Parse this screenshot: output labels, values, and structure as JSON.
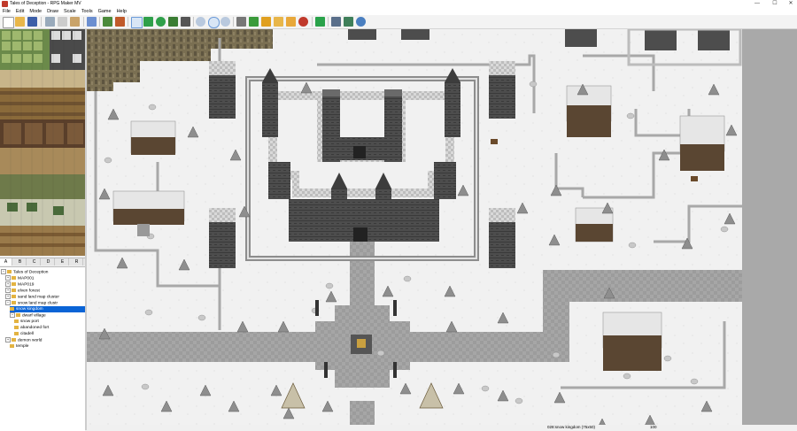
{
  "window": {
    "title": "Tales of Deception - RPG Maker MV",
    "minimize": "—",
    "maximize": "☐",
    "close": "✕"
  },
  "menu": [
    "File",
    "Edit",
    "Mode",
    "Draw",
    "Scale",
    "Tools",
    "Game",
    "Help"
  ],
  "tileset_tabs": [
    {
      "label": "A",
      "active": true
    },
    {
      "label": "B",
      "active": false
    },
    {
      "label": "C",
      "active": false
    },
    {
      "label": "D",
      "active": false
    },
    {
      "label": "E",
      "active": false
    },
    {
      "label": "R",
      "active": false
    }
  ],
  "map_tree": [
    {
      "label": "Tales of Deception",
      "level": 0,
      "expander": "−",
      "selected": false
    },
    {
      "label": "MAP001",
      "level": 1,
      "expander": "+",
      "selected": false
    },
    {
      "label": "MAP019",
      "level": 1,
      "expander": "+",
      "selected": false
    },
    {
      "label": "elven forest",
      "level": 1,
      "expander": "+",
      "selected": false
    },
    {
      "label": "sand land map cluster",
      "level": 1,
      "expander": "+",
      "selected": false
    },
    {
      "label": "snow land map clustr",
      "level": 1,
      "expander": "−",
      "selected": false
    },
    {
      "label": "snow kingdom",
      "level": 2,
      "expander": "",
      "selected": true
    },
    {
      "label": "dwarf village",
      "level": 2,
      "expander": "−",
      "selected": false
    },
    {
      "label": "snow port",
      "level": 2,
      "expander": "",
      "selected": false
    },
    {
      "label": "abandoned fort",
      "level": 2,
      "expander": "",
      "selected": false
    },
    {
      "label": "citadell",
      "level": 2,
      "expander": "",
      "selected": false
    },
    {
      "label": "demon world",
      "level": 1,
      "expander": "+",
      "selected": false
    },
    {
      "label": "temple",
      "level": 2,
      "expander": "",
      "selected": false
    }
  ],
  "toolbar_icons": [
    "new-project-icon",
    "open-project-icon",
    "save-project-icon",
    "cut-icon",
    "copy-icon",
    "paste-icon",
    "undo-icon",
    "map-mode-icon",
    "event-mode-icon",
    "pencil-icon",
    "rectangle-icon",
    "ellipse-icon",
    "fill-icon",
    "shadow-pen-icon",
    "zoom-in-icon",
    "zoom-out-icon",
    "actual-size-icon",
    "database-icon",
    "plugin-manager-icon",
    "sound-test-icon",
    "event-searcher-icon",
    "resource-manager-icon",
    "character-generator-icon",
    "playtest-icon",
    "game-folder-icon",
    "deployment-icon",
    "help-icon"
  ],
  "status": {
    "map": "028:snow kingdom (75x50)",
    "zoom": "100"
  }
}
